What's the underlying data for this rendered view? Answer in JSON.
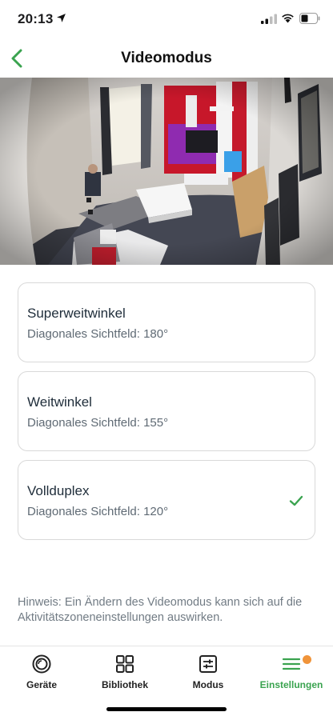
{
  "status_bar": {
    "time": "20:13"
  },
  "nav": {
    "title": "Videomodus"
  },
  "options": [
    {
      "title": "Superweitwinkel",
      "subtitle": "Diagonales Sichtfeld: 180°",
      "selected": false
    },
    {
      "title": "Weitwinkel",
      "subtitle": "Diagonales Sichtfeld: 155°",
      "selected": false
    },
    {
      "title": "Vollduplex",
      "subtitle": "Diagonales Sichtfeld: 120°",
      "selected": true
    }
  ],
  "hint": "Hinweis: Ein Ändern des Videomodus kann sich auf die Aktivitätszoneneinstellungen auswirken.",
  "tabs": [
    {
      "label": "Geräte",
      "icon": "devices-icon",
      "active": false
    },
    {
      "label": "Bibliothek",
      "icon": "grid-icon",
      "active": false
    },
    {
      "label": "Modus",
      "icon": "sliders-icon",
      "active": false
    },
    {
      "label": "Einstellungen",
      "icon": "menu-icon",
      "active": true,
      "badge": true
    }
  ],
  "colors": {
    "accent": "#3aa34f",
    "badge": "#f0943a"
  }
}
